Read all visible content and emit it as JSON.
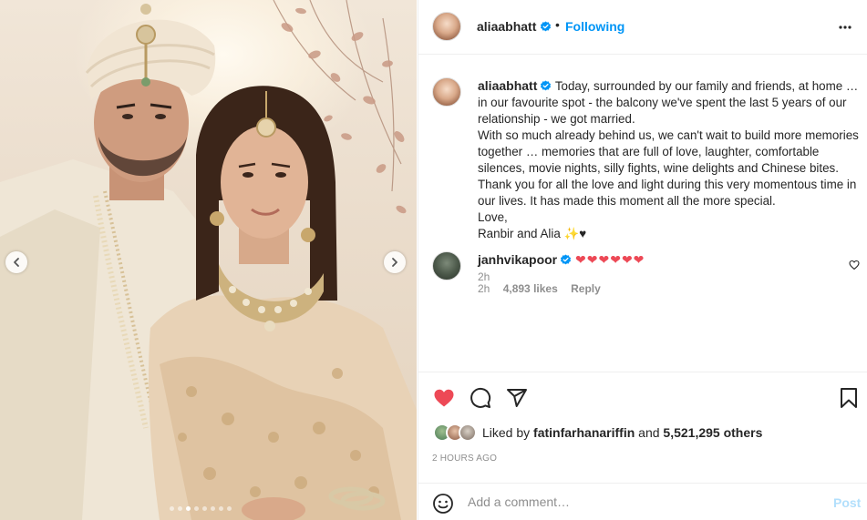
{
  "media": {
    "carousel_total": 8,
    "carousel_active": 2,
    "prev_icon": "chevron-left-icon",
    "next_icon": "chevron-right-icon"
  },
  "header": {
    "username": "aliaabhatt",
    "verified": true,
    "separator": "•",
    "follow_status": "Following",
    "more_icon": "more-options-icon"
  },
  "caption": {
    "username": "aliaabhatt",
    "lines": [
      "Today, surrounded by our family and friends, at home … in our favourite spot - the balcony we've spent the last 5 years of our relationship - we got married.",
      "With so much already behind us, we can't wait to build more memories together … memories that are full of love, laughter, comfortable silences, movie nights, silly fights, wine delights and Chinese bites.",
      "Thank you for all the love and light during this very momentous time in our lives. It has made this moment all the more special.",
      "Love,",
      "Ranbir and Alia ✨♥"
    ],
    "time": "2h"
  },
  "comment": {
    "username": "janhvikapoor",
    "verified": true,
    "text": "❤❤❤❤❤❤",
    "time": "2h",
    "likes": "4,893 likes",
    "reply": "Reply"
  },
  "actions": {
    "like_icon": "heart-filled-icon",
    "comment_icon": "comment-icon",
    "share_icon": "share-icon",
    "save_icon": "bookmark-icon"
  },
  "likes": {
    "prefix": "Liked by",
    "user": "fatinfarhanariffin",
    "and": "and",
    "others": "5,521,295 others"
  },
  "timestamp": "2 HOURS AGO",
  "add_comment": {
    "placeholder": "Add a comment…",
    "post_label": "Post"
  },
  "colors": {
    "accent": "#0095f6",
    "like": "#ed4956",
    "muted": "#8e8e8e",
    "post_disabled": "#b2dffc"
  }
}
